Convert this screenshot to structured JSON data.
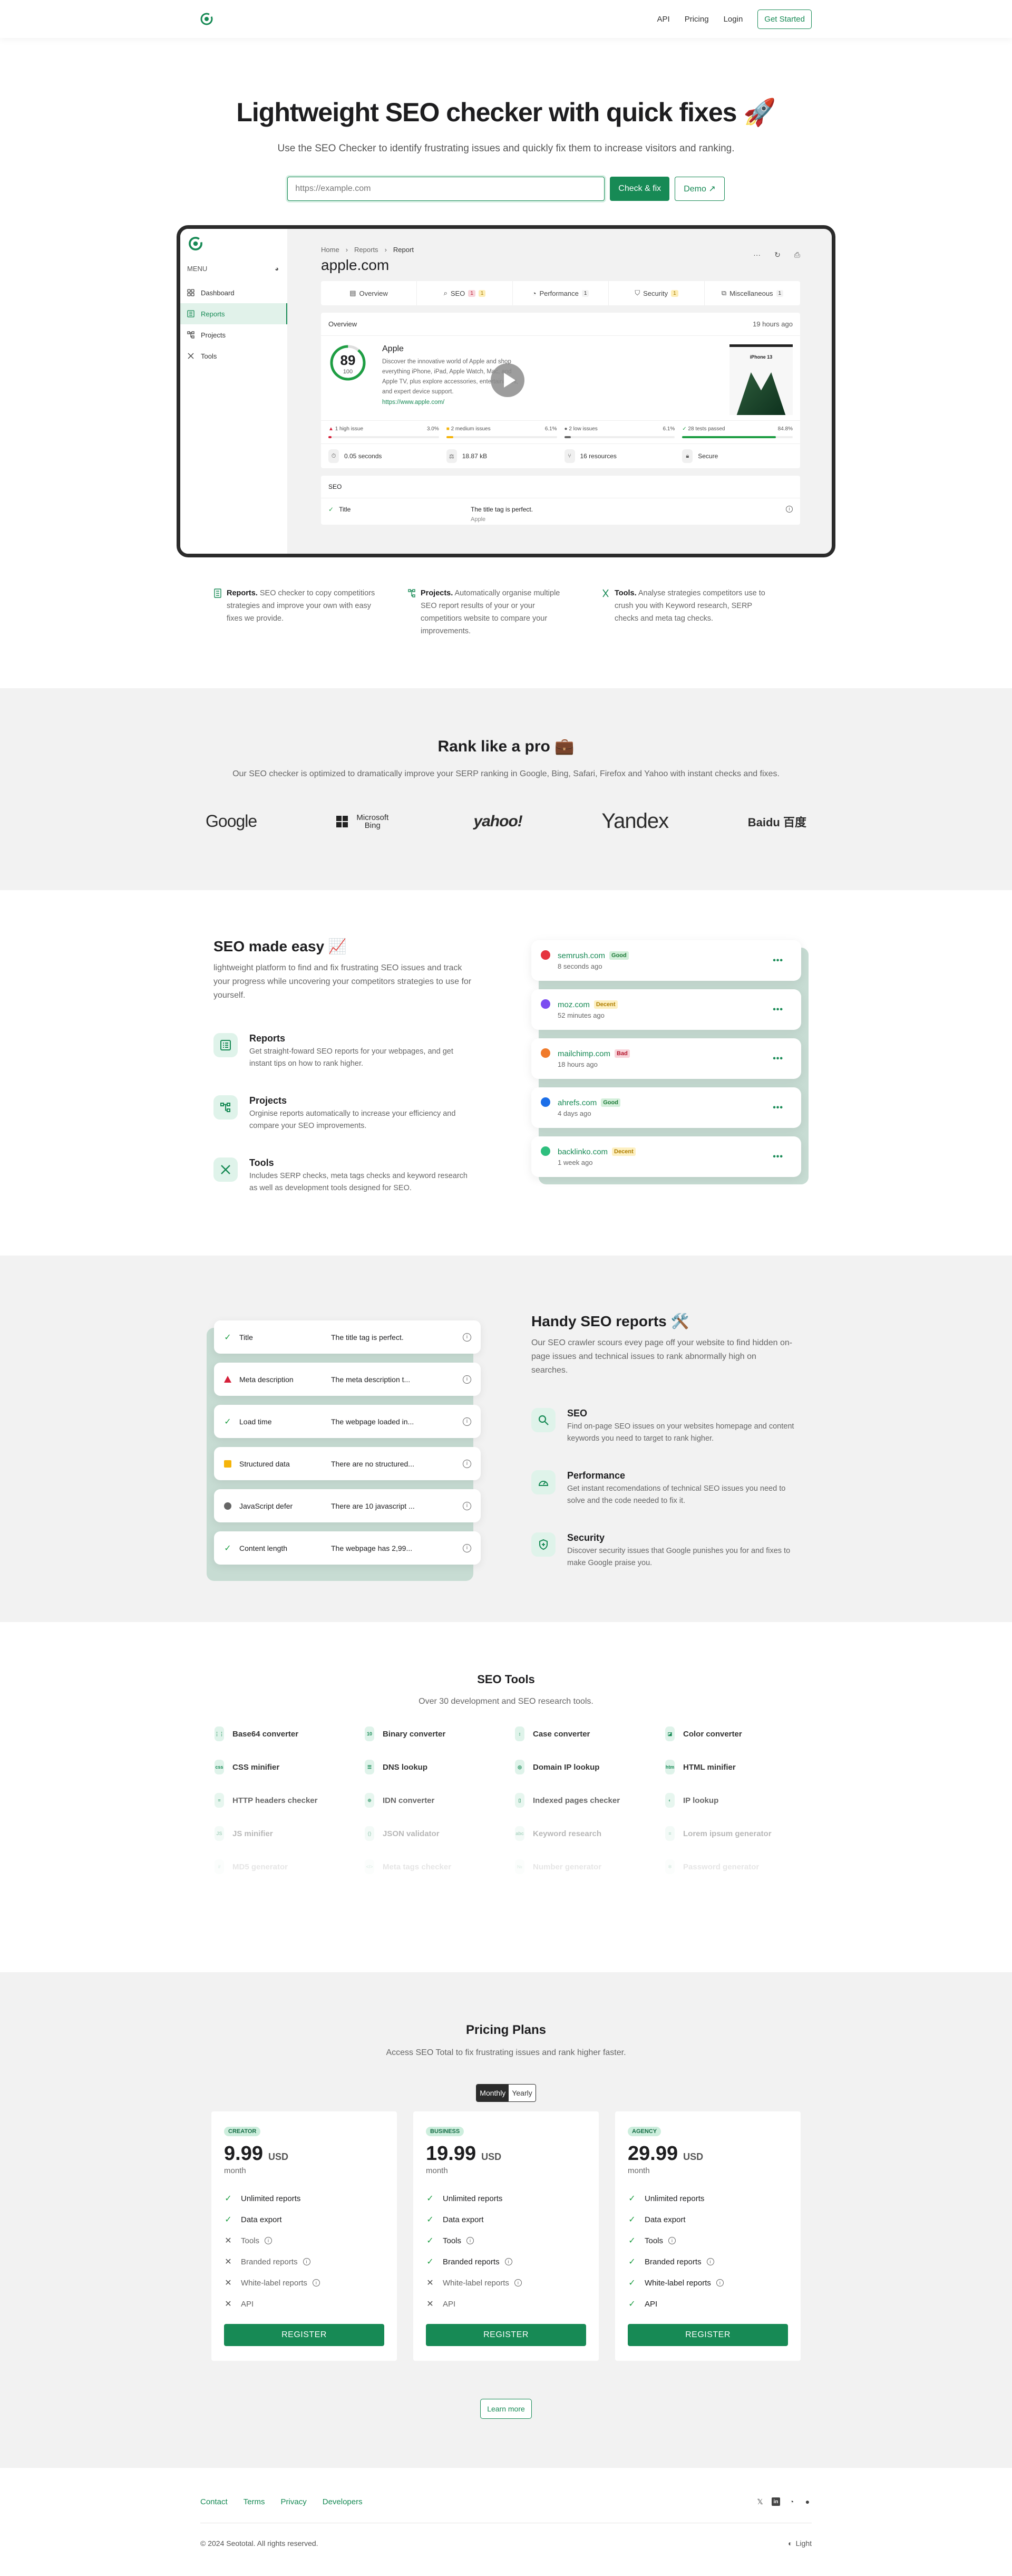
{
  "nav": {
    "links": [
      "API",
      "Pricing",
      "Login"
    ],
    "cta": "Get Started"
  },
  "hero": {
    "title": "Lightweight SEO checker with quick fixes 🚀",
    "subtitle": "Use the SEO Checker to identify frustrating issues and quickly fix them to increase visitors and ranking.",
    "input_placeholder": "https://example.com",
    "check_button": "Check & fix",
    "demo_button": "Demo ↗"
  },
  "mockup": {
    "menu_label": "MENU",
    "sidebar": [
      "Dashboard",
      "Reports",
      "Projects",
      "Tools"
    ],
    "active_item": "Reports",
    "breadcrumb": [
      "Home",
      "Reports",
      "Report"
    ],
    "title": "apple.com",
    "tabs": [
      {
        "label": "Overview",
        "counts": []
      },
      {
        "label": "SEO",
        "counts": [
          {
            "n": "1",
            "kind": "red"
          },
          {
            "n": "1",
            "kind": "yel"
          }
        ]
      },
      {
        "label": "Performance",
        "counts": [
          {
            "n": "1",
            "kind": "gray"
          }
        ]
      },
      {
        "label": "Security",
        "counts": [
          {
            "n": "1",
            "kind": "yel"
          }
        ]
      },
      {
        "label": "Miscellaneous",
        "counts": [
          {
            "n": "1",
            "kind": "gray"
          }
        ]
      }
    ],
    "overview": {
      "heading": "Overview",
      "time": "19 hours ago",
      "score": 89,
      "score_max": 100,
      "site_name": "Apple",
      "description": "Discover the innovative world of Apple and shop everything iPhone, iPad, Apple Watch, Mac, and Apple TV, plus explore accessories, entertainment, and expert device support.",
      "url": "https://www.apple.com/",
      "screenshot_caption": "iPhone 13",
      "issues": [
        {
          "label": "1 high issue",
          "pct": "3.0%",
          "value": 3.0,
          "color": "#d6203a"
        },
        {
          "label": "2 medium issues",
          "pct": "6.1%",
          "value": 6.1,
          "color": "#f5b40a"
        },
        {
          "label": "2 low issues",
          "pct": "6.1%",
          "value": 6.1,
          "color": "#666666"
        },
        {
          "label": "28 tests passed",
          "pct": "84.8%",
          "value": 84.8,
          "color": "#1e9e43"
        }
      ],
      "stats": [
        "0.05 seconds",
        "18.87 kB",
        "16 resources",
        "Secure"
      ]
    },
    "seo_section": {
      "heading": "SEO",
      "row_name": "Title",
      "row_value": "The title tag is perfect.",
      "row_sub": "Apple"
    }
  },
  "trio": [
    {
      "title": "Reports.",
      "text": "SEO checker to copy competitiors strategies and improve your own with easy fixes we provide."
    },
    {
      "title": "Projects.",
      "text": "Automatically organise multiple SEO report results of your or your competitiors website to compare your improvements."
    },
    {
      "title": "Tools.",
      "text": "Analyse strategies competitors use to crush you with Keyword research, SERP checks and meta tag checks."
    }
  ],
  "rank": {
    "title": "Rank like a pro 💼",
    "subtitle": "Our SEO checker is optimized to dramatically improve your SERP ranking in Google, Bing, Safari, Firefox and Yahoo with instant checks and fixes.",
    "logos": [
      "Google",
      "Microsoft Bing",
      "yahoo!",
      "Yandex",
      "Baidu 百度"
    ]
  },
  "easy": {
    "title": "SEO made easy 📈",
    "lead": "lightweight platform to find and fix frustrating SEO issues and track your progress while uncovering your competitors strategies to use for yourself.",
    "features": [
      {
        "title": "Reports",
        "text": "Get straight-foward SEO reports for your webpages, and get instant tips on how to rank higher."
      },
      {
        "title": "Projects",
        "text": "Orginise reports automatically to increase your efficiency and compare your SEO improvements."
      },
      {
        "title": "Tools",
        "text": "Includes SERP checks, meta tags checks and keyword research as well as development tools designed for SEO."
      }
    ],
    "sites": [
      {
        "name": "semrush.com",
        "badge": "Good",
        "kind": "good",
        "time": "8 seconds ago",
        "color": "#e5343f"
      },
      {
        "name": "moz.com",
        "badge": "Decent",
        "kind": "decent",
        "time": "52 minutes ago",
        "color": "#7b4df0"
      },
      {
        "name": "mailchimp.com",
        "badge": "Bad",
        "kind": "bad",
        "time": "18 hours ago",
        "color": "#f07a2a"
      },
      {
        "name": "ahrefs.com",
        "badge": "Good",
        "kind": "good",
        "time": "4 days ago",
        "color": "#1b6ee8"
      },
      {
        "name": "backlinko.com",
        "badge": "Decent",
        "kind": "decent",
        "time": "1 week ago",
        "color": "#2ebf7e"
      }
    ]
  },
  "handy": {
    "title": "Handy SEO reports 🛠️",
    "lead": "Our SEO crawler scours evey page off your website to find hidden on-page issues and technical issues to rank abnormally high on searches.",
    "checks": [
      {
        "label": "Title",
        "msg": "The title tag is perfect.",
        "status": "pass"
      },
      {
        "label": "Meta description",
        "msg": "The meta description t...",
        "status": "high"
      },
      {
        "label": "Load time",
        "msg": "The webpage loaded in...",
        "status": "pass"
      },
      {
        "label": "Structured data",
        "msg": "There are no structured...",
        "status": "medium"
      },
      {
        "label": "JavaScript defer",
        "msg": "There are 10 javascript ...",
        "status": "low"
      },
      {
        "label": "Content length",
        "msg": "The webpage has 2,99...",
        "status": "pass"
      }
    ],
    "features": [
      {
        "title": "SEO",
        "text": "Find on-page SEO issues on your websites homepage and content keywords you need to target to rank higher."
      },
      {
        "title": "Performance",
        "text": "Get instant recomendations of technical SEO issues you need to solve and the code needed to fix it."
      },
      {
        "title": "Security",
        "text": "Discover security issues that Google punishes you for and fixes to make Google praise you."
      }
    ]
  },
  "tools": {
    "title": "SEO Tools",
    "subtitle": "Over 30 development and SEO research tools.",
    "items": [
      {
        "label": "Base64 converter",
        "icon": "⋮⋮"
      },
      {
        "label": "Binary converter",
        "icon": "10"
      },
      {
        "label": "Case converter",
        "icon": "↕"
      },
      {
        "label": "Color converter",
        "icon": "◪"
      },
      {
        "label": "CSS minifier",
        "icon": "css"
      },
      {
        "label": "DNS lookup",
        "icon": "☰"
      },
      {
        "label": "Domain IP lookup",
        "icon": "◎"
      },
      {
        "label": "HTML minifier",
        "icon": "htm"
      },
      {
        "label": "HTTP headers checker",
        "icon": "≡"
      },
      {
        "label": "IDN converter",
        "icon": "⊕"
      },
      {
        "label": "Indexed pages checker",
        "icon": "▯"
      },
      {
        "label": "IP lookup",
        "icon": "◐"
      },
      {
        "label": "JS minifier",
        "icon": "JS"
      },
      {
        "label": "JSON validator",
        "icon": "{}"
      },
      {
        "label": "Keyword research",
        "icon": "abc"
      },
      {
        "label": "Lorem ipsum generator",
        "icon": "≡"
      },
      {
        "label": "MD5 generator",
        "icon": "#"
      },
      {
        "label": "Meta tags checker",
        "icon": "</>"
      },
      {
        "label": "Number generator",
        "icon": "№"
      },
      {
        "label": "Password generator",
        "icon": "✱"
      }
    ]
  },
  "pricing": {
    "title": "Pricing Plans",
    "subtitle": "Access SEO Total to fix frustrating issues and rank higher faster.",
    "toggle": [
      "Monthly",
      "Yearly"
    ],
    "active_toggle": "Monthly",
    "plans": [
      {
        "tag": "CREATOR",
        "price": "9.99",
        "currency": "USD",
        "period": "month",
        "features": [
          {
            "label": "Unlimited reports",
            "on": true,
            "info": false
          },
          {
            "label": "Data export",
            "on": true,
            "info": false
          },
          {
            "label": "Tools",
            "on": false,
            "info": true
          },
          {
            "label": "Branded reports",
            "on": false,
            "info": true
          },
          {
            "label": "White-label reports",
            "on": false,
            "info": true
          },
          {
            "label": "API",
            "on": false,
            "info": false
          }
        ],
        "button": "REGISTER"
      },
      {
        "tag": "BUSINESS",
        "price": "19.99",
        "currency": "USD",
        "period": "month",
        "features": [
          {
            "label": "Unlimited reports",
            "on": true,
            "info": false
          },
          {
            "label": "Data export",
            "on": true,
            "info": false
          },
          {
            "label": "Tools",
            "on": true,
            "info": true
          },
          {
            "label": "Branded reports",
            "on": true,
            "info": true
          },
          {
            "label": "White-label reports",
            "on": false,
            "info": true
          },
          {
            "label": "API",
            "on": false,
            "info": false
          }
        ],
        "button": "REGISTER"
      },
      {
        "tag": "AGENCY",
        "price": "29.99",
        "currency": "USD",
        "period": "month",
        "features": [
          {
            "label": "Unlimited reports",
            "on": true,
            "info": false
          },
          {
            "label": "Data export",
            "on": true,
            "info": false
          },
          {
            "label": "Tools",
            "on": true,
            "info": true
          },
          {
            "label": "Branded reports",
            "on": true,
            "info": true
          },
          {
            "label": "White-label reports",
            "on": true,
            "info": true
          },
          {
            "label": "API",
            "on": true,
            "info": false
          }
        ],
        "button": "REGISTER"
      }
    ],
    "learn_more": "Learn more"
  },
  "footer": {
    "links": [
      "Contact",
      "Terms",
      "Privacy",
      "Developers"
    ],
    "social": [
      "x-icon",
      "linkedin-icon",
      "github-icon",
      "reddit-icon"
    ],
    "copyright": "© 2024 Seototal. All rights reserved.",
    "theme": "Light"
  },
  "colors": {
    "brand": "#178a55",
    "band": "#f2f2f2",
    "pass": "#1e9e43",
    "high": "#d6203a",
    "medium": "#f5b40a",
    "low": "#666666"
  }
}
